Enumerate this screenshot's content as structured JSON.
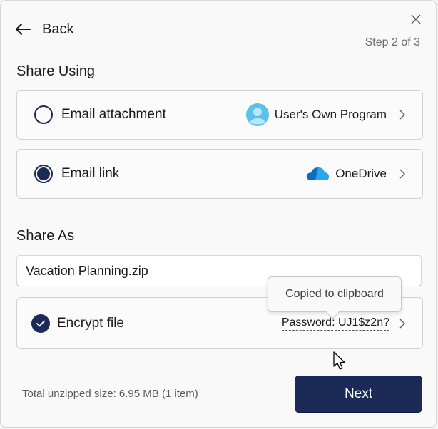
{
  "window": {
    "close_icon": "close-icon",
    "back_label": "Back",
    "back_icon": "arrow-left-icon",
    "step": "Step 2 of 3"
  },
  "share_using": {
    "title": "Share Using",
    "options": [
      {
        "label": "Email attachment",
        "selected": false,
        "provider": "User's Own Program",
        "provider_icon": "user-avatar-icon"
      },
      {
        "label": "Email link",
        "selected": true,
        "provider": "OneDrive",
        "provider_icon": "onedrive-cloud-icon"
      }
    ]
  },
  "share_as": {
    "title": "Share As",
    "filename": "Vacation Planning.zip"
  },
  "encrypt": {
    "label": "Encrypt file",
    "checked": true,
    "password": "Password: UJ1$z2n?",
    "tooltip": "Copied to clipboard"
  },
  "footer": {
    "total_size": "Total unzipped size:  6.95 MB  (1 item)",
    "next_label": "Next"
  },
  "colors": {
    "accent": "#1b2a57",
    "onedrive": "#0f6cbd",
    "avatar": "#5bc0eb"
  }
}
